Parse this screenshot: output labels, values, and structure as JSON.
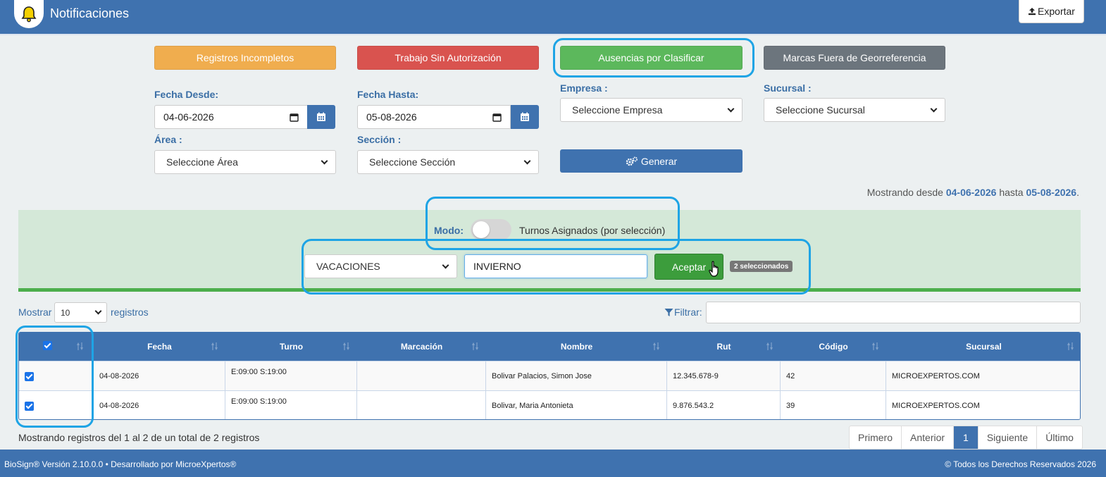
{
  "header": {
    "title": "Notificaciones",
    "export_label": "Exportar"
  },
  "categories": [
    {
      "label": "Registros Incompletos",
      "color": "#f0ad4e"
    },
    {
      "label": "Trabajo Sin Autorización",
      "color": "#d9534f"
    },
    {
      "label": "Ausencias por Clasificar",
      "color": "#5cb85c"
    },
    {
      "label": "Marcas Fuera de Georreferencia",
      "color": "#6c757d"
    }
  ],
  "filters": {
    "fecha_desde": {
      "label": "Fecha Desde:",
      "value": "04-06-2026"
    },
    "fecha_hasta": {
      "label": "Fecha Hasta:",
      "value": "05-08-2026"
    },
    "empresa": {
      "label": "Empresa :",
      "value": "Seleccione Empresa"
    },
    "sucursal": {
      "label": "Sucursal :",
      "value": "Seleccione Sucursal"
    },
    "area": {
      "label": "Área :",
      "value": "Seleccione Área"
    },
    "seccion": {
      "label": "Sección :",
      "value": "Seleccione Sección"
    },
    "generate_label": "Generar"
  },
  "range": {
    "prefix": "Mostrando desde",
    "from": "04-06-2026",
    "middle": "hasta",
    "to": "05-08-2026",
    "suffix": "."
  },
  "mode_panel": {
    "mode_label": "Modo:",
    "mode_text": "Turnos Asignados (por selección)",
    "type_value": "VACACIONES",
    "text_value": "INVIERNO",
    "accept_label": "Aceptar",
    "selected_badge": "2 seleccionados"
  },
  "table_controls": {
    "show_label": "Mostrar",
    "page_length": "10",
    "records_label": "registros",
    "filter_label": "Filtrar:"
  },
  "table": {
    "columns": [
      "Fecha",
      "Turno",
      "Marcación",
      "Nombre",
      "Rut",
      "Código",
      "Sucursal"
    ],
    "rows": [
      {
        "fecha": "04-08-2026",
        "turno": "E:09:00 S:19:00",
        "marcacion": "",
        "nombre": "Bolivar Palacios, Simon Jose",
        "rut": "12.345.678-9",
        "codigo": "42",
        "sucursal": "MICROEXPERTOS.COM"
      },
      {
        "fecha": "04-08-2026",
        "turno": "E:09:00 S:19:00",
        "marcacion": "",
        "nombre": "Bolivar, Maria Antonieta",
        "rut": "9.876.543.2",
        "codigo": "39",
        "sucursal": "MICROEXPERTOS.COM"
      }
    ]
  },
  "info": "Mostrando registros del 1 al 2 de un total de 2 registros",
  "pagination": {
    "first": "Primero",
    "prev": "Anterior",
    "current": "1",
    "next": "Siguiente",
    "last": "Último"
  },
  "footer": {
    "left": "BioSign® Versión 2.10.0.0 • Desarrollado por MicroeXpertos®",
    "right": "© Todos los Derechos Reservados 2026"
  }
}
